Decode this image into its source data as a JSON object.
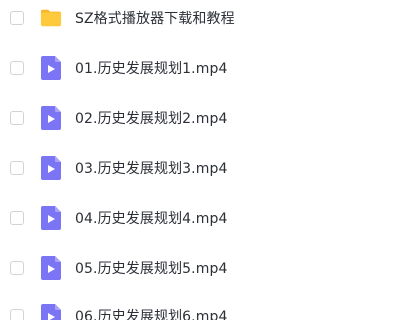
{
  "colors": {
    "folder": "#FFC93D",
    "folder_tab": "#F7B52C",
    "video_icon": "#7B74F5",
    "video_icon_light": "#A9A4FA",
    "text": "#2B2F36",
    "checkbox_border": "#CFD3DA"
  },
  "items": [
    {
      "name": "SZ格式播放器下载和教程",
      "type": "folder",
      "icon": "folder-icon"
    },
    {
      "name": "01.历史发展规划1.mp4",
      "type": "video",
      "icon": "video-file-icon"
    },
    {
      "name": "02.历史发展规划2.mp4",
      "type": "video",
      "icon": "video-file-icon"
    },
    {
      "name": "03.历史发展规划3.mp4",
      "type": "video",
      "icon": "video-file-icon"
    },
    {
      "name": "04.历史发展规划4.mp4",
      "type": "video",
      "icon": "video-file-icon"
    },
    {
      "name": "05.历史发展规划5.mp4",
      "type": "video",
      "icon": "video-file-icon"
    },
    {
      "name": "06.历史发展规划6.mp4",
      "type": "video",
      "icon": "video-file-icon"
    }
  ]
}
